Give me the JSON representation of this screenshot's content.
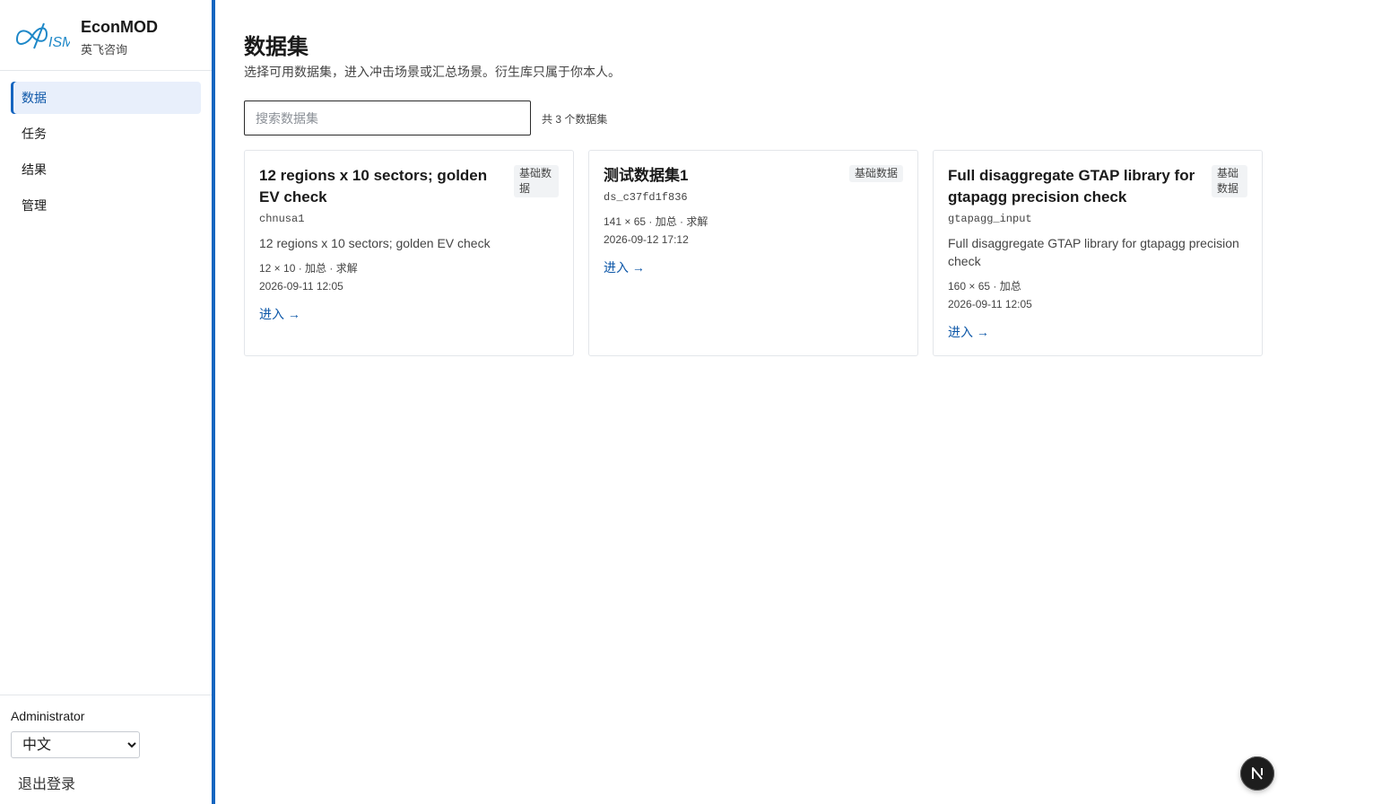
{
  "brand": {
    "logo_text": "ISM",
    "name": "EconMOD",
    "subtitle": "英飞咨询"
  },
  "nav": {
    "items": [
      {
        "label": "数据",
        "active": true
      },
      {
        "label": "任务",
        "active": false
      },
      {
        "label": "结果",
        "active": false
      },
      {
        "label": "管理",
        "active": false
      }
    ]
  },
  "footer": {
    "user": "Administrator",
    "language": "中文",
    "logout_label": "退出登录"
  },
  "page": {
    "title": "数据集",
    "subtitle": "选择可用数据集，进入冲击场景或汇总场景。衍生库只属于你本人。"
  },
  "search": {
    "placeholder": "搜索数据集",
    "value": ""
  },
  "count_label": "共 3 个数据集",
  "datasets": [
    {
      "title": "12 regions x 10 sectors; golden EV check",
      "badge": "基础数据",
      "id": "chnusa1",
      "description": "12 regions x 10 sectors; golden EV check",
      "meta": "12 × 10 · 加总 · 求解",
      "date": "2026-09-11 12:05",
      "link": "进入 →"
    },
    {
      "title": "测试数据集1",
      "badge": "基础数据",
      "id": "ds_c37fd1f836",
      "description": "",
      "meta": "141 × 65 · 加总 · 求解",
      "date": "2026-09-12 17:12",
      "link": "进入 →"
    },
    {
      "title": "Full disaggregate GTAP library for gtapagg precision check",
      "badge": "基础数据",
      "id": "gtapagg_input",
      "description": "Full disaggregate GTAP library for gtapagg precision check",
      "meta": "160 × 65 · 加总",
      "date": "2026-09-11 12:05",
      "link": "进入 →"
    }
  ],
  "dev_badge": {
    "letter": "N",
    "icon": "nextjs-icon"
  },
  "colors": {
    "accent": "#1565c0",
    "link": "#0d57a8",
    "active_bg": "#e8effb",
    "logo_blue": "#1e88c8"
  }
}
